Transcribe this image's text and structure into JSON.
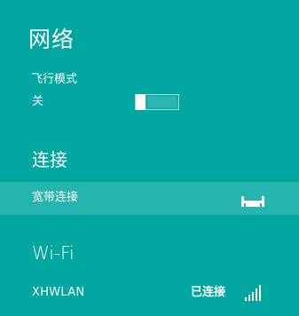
{
  "panel": {
    "title": "网络"
  },
  "airplane_mode": {
    "label": "飞行模式",
    "state": "关",
    "on": false
  },
  "connections": {
    "title": "连接",
    "items": [
      {
        "name": "宽带连接",
        "icon": "ethernet-icon"
      }
    ]
  },
  "wifi": {
    "title": "Wi-Fi",
    "networks": [
      {
        "name": "XHWLAN",
        "status": "已连接",
        "icon": "wifi-signal-icon",
        "signal_bars": 5,
        "signal_bars_max": 5
      }
    ]
  },
  "colors": {
    "background": "#00a7a0",
    "highlight": "#25b4ae",
    "text": "#ffffff"
  }
}
